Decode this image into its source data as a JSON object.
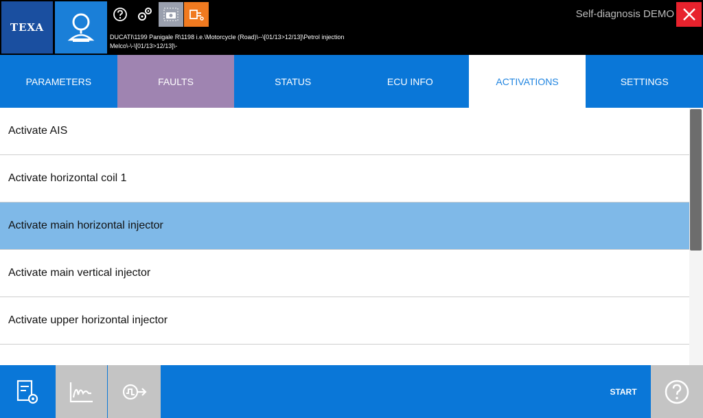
{
  "header": {
    "logo_text": "TEXA",
    "app_title": "Self-diagnosis DEMO",
    "vehicle_path_line1": "DUCATI\\1199 Panigale R\\1198 i.e.\\Motorcycle (Road)\\--\\[01/13>12/13]\\Petrol injection",
    "vehicle_path_line2": "Melco\\-\\-\\[01/13>12/13]\\-",
    "icons": [
      "diagnosis-magnifier-icon",
      "help-icon",
      "gears-icon",
      "camera-icon",
      "plug-icon",
      "close-icon"
    ],
    "colors": {
      "logo_bg": "#1a4fa0",
      "diag_bg": "#1a7fd8",
      "camera_bg": "#9aa0ae",
      "plug_bg": "#f07a20",
      "close_bg": "#e8222d"
    }
  },
  "tabs": [
    {
      "label": "PARAMETERS"
    },
    {
      "label": "FAULTS"
    },
    {
      "label": "STATUS"
    },
    {
      "label": "ECU INFO"
    },
    {
      "label": "ACTIVATIONS",
      "active": true
    },
    {
      "label": "SETTINGS"
    }
  ],
  "activations": [
    {
      "label": "Activate AIS"
    },
    {
      "label": "Activate horizontal coil 1"
    },
    {
      "label": "Activate main horizontal injector",
      "selected": true
    },
    {
      "label": "Activate main vertical injector"
    },
    {
      "label": "Activate upper horizontal injector"
    },
    {
      "label": ""
    }
  ],
  "footer": {
    "start_label": "START",
    "icons": [
      "ecu-settings-icon",
      "graph-icon",
      "signal-output-icon",
      "help-circle-icon"
    ]
  },
  "colors": {
    "primary": "#0a77d8",
    "faults_tab": "#9f84b1",
    "selected_row": "#7fb9e8",
    "gray_button": "#c4c4c4"
  }
}
